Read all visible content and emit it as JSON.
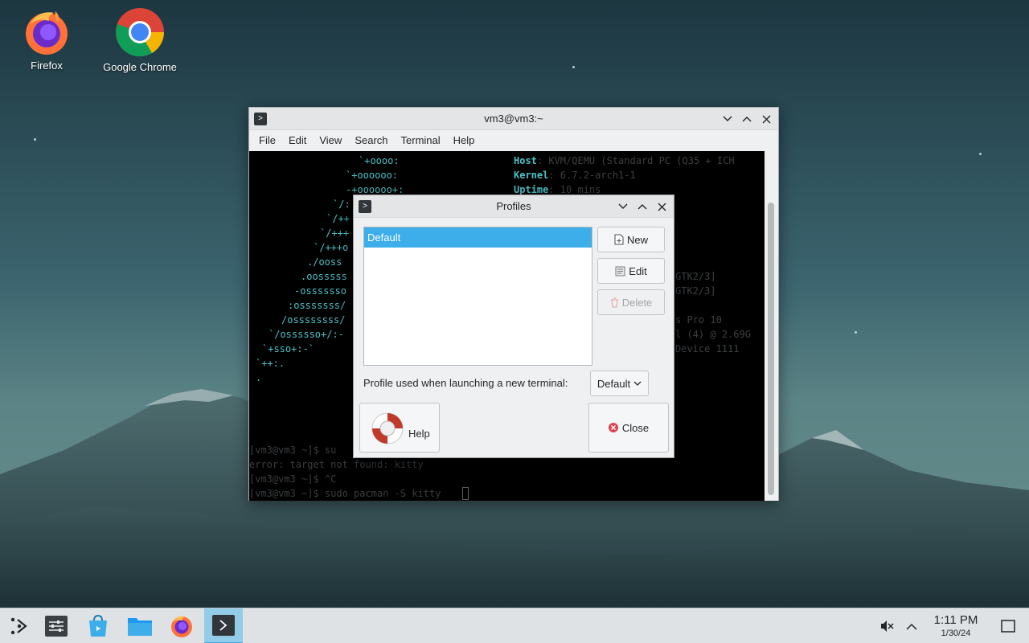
{
  "desktop": {
    "icons": [
      {
        "label": "Firefox",
        "icon": "firefox-icon"
      },
      {
        "label": "Google Chrome",
        "icon": "chrome-icon"
      }
    ]
  },
  "terminal": {
    "title": "vm3@vm3:~",
    "menu": [
      "File",
      "Edit",
      "View",
      "Search",
      "Terminal",
      "Help"
    ],
    "art_lines": [
      "`+oooo:",
      "`+oooooo:",
      "-+oooooo+:",
      "`/:",
      "`/++",
      "`/+++",
      "`/+++o",
      "./ooss",
      ".oosssss",
      "-osssssso",
      ":osssssss/",
      "/ossssssss/",
      "`/ossssso+/:-",
      "`+sso+:-`",
      "`++:.",
      "."
    ],
    "info": [
      {
        "label": "Host",
        "value": ": KVM/QEMU (Standard PC (Q35 + ICH"
      },
      {
        "label": "Kernel",
        "value": ": 6.7.2-arch1-1"
      },
      {
        "label": "Uptime",
        "value": ": 10 mins"
      }
    ],
    "right_fragments": [
      "GTK2/3]",
      "GTK2/3]",
      "s Pro 10",
      "l (4) @ 2.69G",
      "Device 1111"
    ],
    "prompt_lines": [
      "[vm3@vm3 ~]$ su",
      "error: target not found: kitty",
      "[vm3@vm3 ~]$ ^C",
      "[vm3@vm3 ~]$ sudo pacman -S kitty"
    ]
  },
  "profiles_dialog": {
    "title": "Profiles",
    "list": [
      "Default"
    ],
    "buttons": {
      "new": "New",
      "edit": "Edit",
      "delete": "Delete",
      "help": "Help",
      "close": "Close"
    },
    "launch_label": "Profile used when launching a new terminal:",
    "launch_value": "Default"
  },
  "taskbar": {
    "items": [
      "launcher-icon",
      "settings-icon",
      "discover-icon",
      "files-icon",
      "firefox-icon",
      "terminal-icon"
    ],
    "clock_time": "1:11 PM",
    "clock_date": "1/30/24"
  },
  "colors": {
    "accent": "#3daee9",
    "terminal_cyan": "#4cc3c8",
    "close_red": "#da4453"
  }
}
